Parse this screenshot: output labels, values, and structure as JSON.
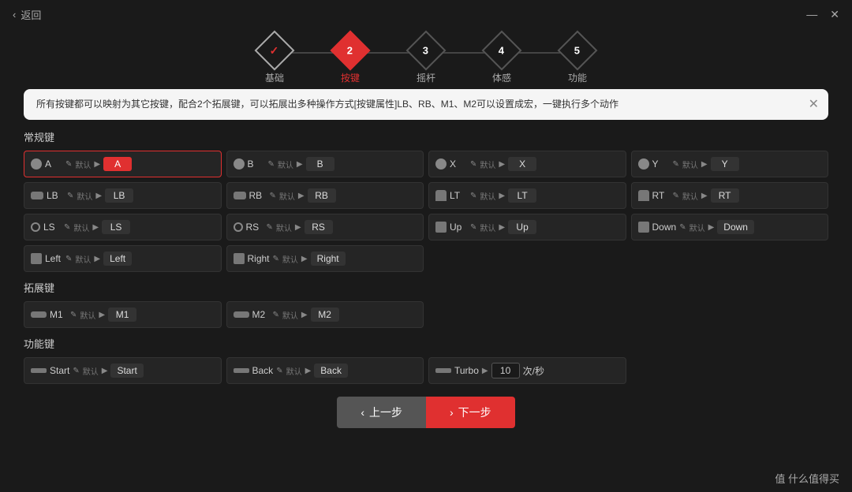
{
  "titleBar": {
    "back": "返回",
    "minimize": "—",
    "close": "✕"
  },
  "wizard": {
    "steps": [
      {
        "id": 1,
        "label": "基础",
        "state": "done",
        "icon": "✓"
      },
      {
        "id": 2,
        "label": "按键",
        "state": "active"
      },
      {
        "id": 3,
        "label": "摇杆",
        "state": "normal"
      },
      {
        "id": 4,
        "label": "体感",
        "state": "normal"
      },
      {
        "id": 5,
        "label": "功能",
        "state": "normal"
      }
    ]
  },
  "infoBox": {
    "text": "所有按键都可以映射为其它按键，配合2个拓展键，可以拓展出多种操作方式[按键属性]LB、RB、M1、M2可以设置成宏，一键执行多个动作",
    "close": "✕"
  },
  "sections": {
    "regular": {
      "title": "常规键",
      "keys": [
        {
          "icon": "circle",
          "name": "A",
          "default": "默认",
          "value": "A",
          "active": true
        },
        {
          "icon": "circle",
          "name": "B",
          "default": "默认",
          "value": "B",
          "active": false
        },
        {
          "icon": "circle",
          "name": "X",
          "default": "默认",
          "value": "X",
          "active": false
        },
        {
          "icon": "circle",
          "name": "Y",
          "default": "默认",
          "value": "Y",
          "active": false
        },
        {
          "icon": "bumper",
          "name": "LB",
          "default": "默认",
          "value": "LB",
          "active": false
        },
        {
          "icon": "bumper",
          "name": "RB",
          "default": "默认",
          "value": "RB",
          "active": false
        },
        {
          "icon": "trigger",
          "name": "LT",
          "default": "默认",
          "value": "LT",
          "active": false
        },
        {
          "icon": "trigger",
          "name": "RT",
          "default": "默认",
          "value": "RT",
          "active": false
        },
        {
          "icon": "stick",
          "name": "LS",
          "default": "默认",
          "value": "LS",
          "active": false
        },
        {
          "icon": "stick",
          "name": "RS",
          "default": "默认",
          "value": "RS",
          "active": false
        },
        {
          "icon": "square",
          "name": "Up",
          "default": "默认",
          "value": "Up",
          "active": false
        },
        {
          "icon": "square",
          "name": "Down",
          "default": "默认",
          "value": "Down",
          "active": false
        },
        {
          "icon": "square",
          "name": "Left",
          "default": "默认",
          "value": "Left",
          "active": false
        },
        {
          "icon": "square",
          "name": "Right",
          "default": "默认",
          "value": "Right",
          "active": false
        }
      ]
    },
    "extended": {
      "title": "拓展键",
      "keys": [
        {
          "icon": "ext",
          "name": "M1",
          "default": "默认",
          "value": "M1",
          "active": false
        },
        {
          "icon": "ext",
          "name": "M2",
          "default": "默认",
          "value": "M2",
          "active": false
        }
      ]
    },
    "function": {
      "title": "功能键",
      "keys": [
        {
          "icon": "func",
          "name": "Start",
          "default": "默认",
          "value": "Start",
          "active": false
        },
        {
          "icon": "func",
          "name": "Back",
          "default": "默认",
          "value": "Back",
          "active": false
        },
        {
          "icon": "func-turbo",
          "name": "Turbo",
          "default": "",
          "value": "10",
          "unit": "次/秒",
          "active": false
        }
      ]
    }
  },
  "bottomNav": {
    "prev_icon": "‹",
    "prev_label": "上一步",
    "next_icon": "›",
    "next_label": "下一步"
  },
  "watermark": "值 什么值得买"
}
